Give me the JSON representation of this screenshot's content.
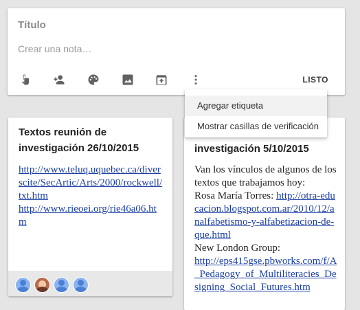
{
  "composer": {
    "title_placeholder": "Título",
    "body_placeholder": "Crear una nota…",
    "done_label": "LISTO",
    "tools": [
      {
        "icon": "remind-me-icon"
      },
      {
        "icon": "collaborator-icon"
      },
      {
        "icon": "change-color-icon"
      },
      {
        "icon": "add-image-icon"
      },
      {
        "icon": "archive-icon"
      },
      {
        "icon": "more-vert-icon"
      }
    ]
  },
  "more_menu": {
    "items": [
      {
        "label": "Agregar etiqueta",
        "highlighted": true
      },
      {
        "label": "Mostrar casillas de verificación",
        "highlighted": false
      }
    ]
  },
  "notes": [
    {
      "title_lines": [
        "Textos reunión de",
        "investigación 26/10/2015"
      ],
      "body": [
        {
          "type": "link",
          "text": "http://www.teluq.uquebec.ca/diverscite/SecArtic/Arts/2000/rockwell/txt.htm"
        },
        {
          "type": "link",
          "text": "http://www.rieoei.org/rie46a06.htm"
        }
      ],
      "collaborators": [
        "default",
        "photo",
        "default",
        "default"
      ]
    },
    {
      "title_lines": [
        "investigación 5/10/2015"
      ],
      "body": [
        {
          "type": "text",
          "text": "Van los vínculos de algunos de los textos que trabajamos hoy:"
        },
        {
          "type": "text",
          "text": "Rosa María Torres: "
        },
        {
          "type": "link",
          "text": "http://otra-educacion.blogspot.com.ar/2010/12/analfabetismo-y-alfabetizacion-de-que.html"
        },
        {
          "type": "text",
          "text": "New London Group:"
        },
        {
          "type": "link",
          "text": "http://eps415gse.pbworks.com/f/A_Pedagogy_of_Multiliteracies_Designing_Social_Futures.htm"
        }
      ]
    }
  ],
  "colors": {
    "link": "#1a3ea6",
    "background": "#e5e5e5",
    "menu_highlight": "#f2f2f2"
  }
}
